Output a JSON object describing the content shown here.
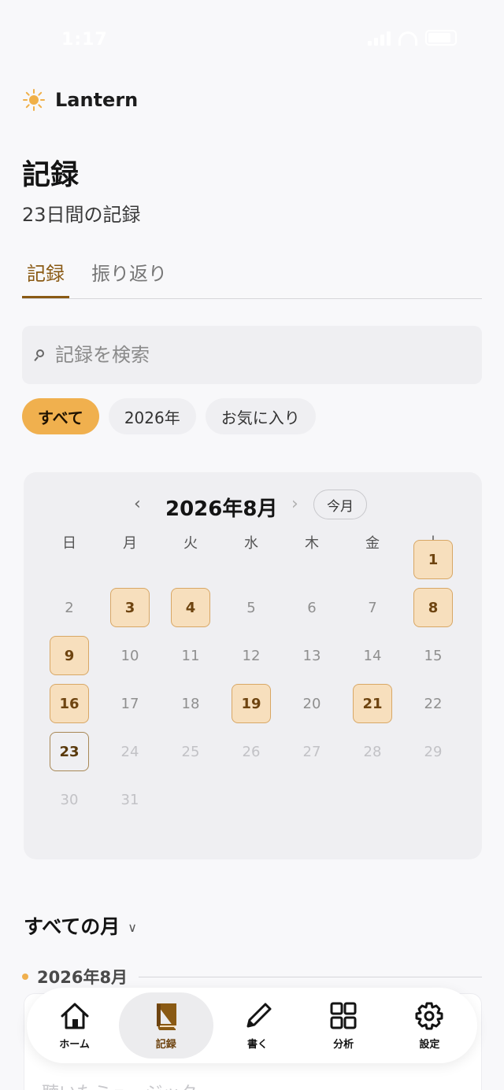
{
  "status": {
    "time": "1:17"
  },
  "brand": {
    "name": "Lantern",
    "icon": "sun-icon"
  },
  "page": {
    "title": "記録",
    "subtitle": "23日間の記録"
  },
  "tabs": [
    {
      "label": "記録",
      "active": true
    },
    {
      "label": "振り返り",
      "active": false
    }
  ],
  "search": {
    "placeholder": "記録を検索",
    "value": ""
  },
  "filters": [
    {
      "label": "すべて",
      "active": true
    },
    {
      "label": "2026年",
      "active": false
    },
    {
      "label": "お気に入り",
      "active": false
    }
  ],
  "calendar": {
    "month_label": "2026年8月",
    "prev_icon": "chevron-left-icon",
    "next_icon": "chevron-right-icon",
    "today_label": "今月",
    "weekdays": [
      "日",
      "月",
      "火",
      "水",
      "木",
      "金",
      "土"
    ],
    "first_weekday": 6,
    "days_in_month": 31,
    "today": 23,
    "entry_days": [
      1,
      3,
      4,
      8,
      9,
      16,
      19,
      21
    ]
  },
  "list": {
    "months_label": "すべての月",
    "month_heading": "2026年8月",
    "entry_preview": "聴いたミュージック"
  },
  "tabbar": [
    {
      "label": "ホーム",
      "icon": "home-icon",
      "active": false
    },
    {
      "label": "記録",
      "icon": "book-icon",
      "active": true
    },
    {
      "label": "書く",
      "icon": "pencil-icon",
      "active": false
    },
    {
      "label": "分析",
      "icon": "grid-icon",
      "active": false
    },
    {
      "label": "設定",
      "icon": "gear-icon",
      "active": false
    }
  ],
  "colors": {
    "accent": "#f0b04e",
    "accent_dark": "#8a5a14",
    "entry_bg": "#f7dfbd"
  }
}
